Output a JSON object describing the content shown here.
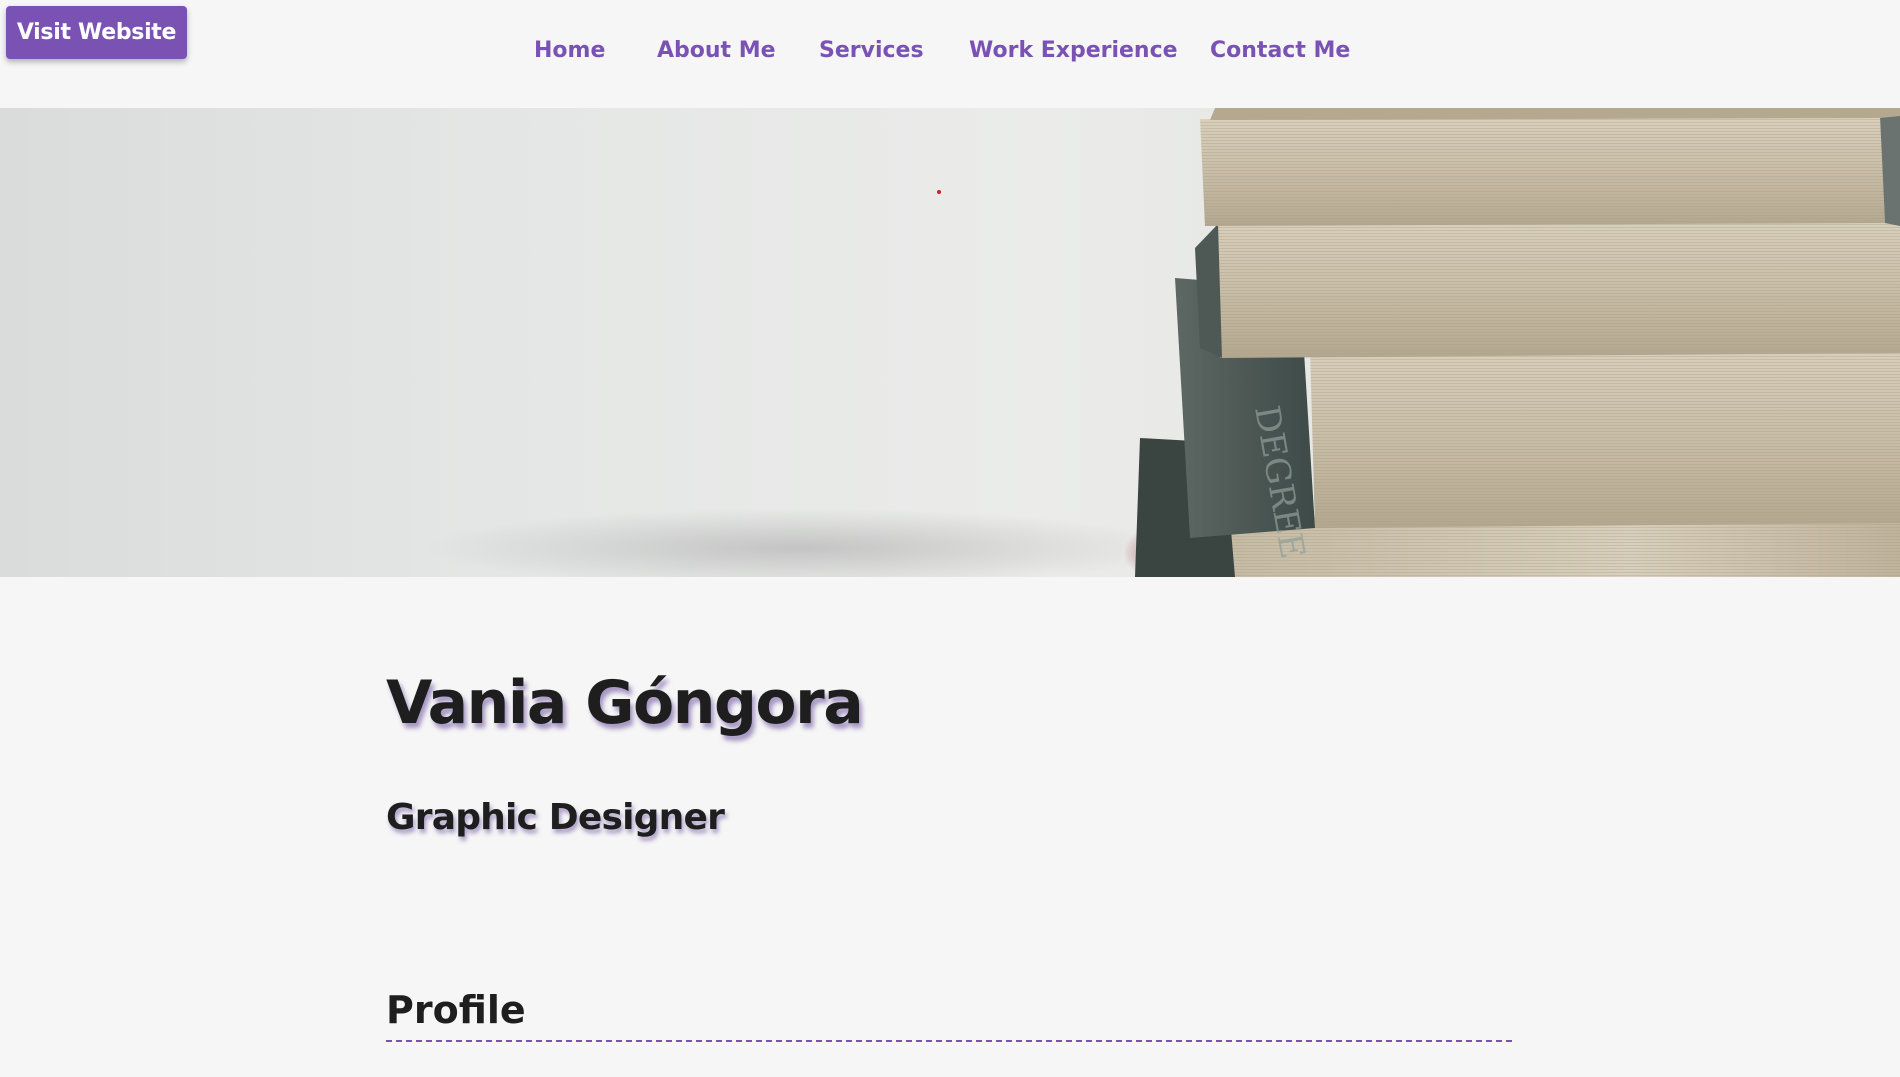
{
  "header": {
    "visit_button_label": "Visit Website",
    "nav": {
      "home": "Home",
      "about": "About Me",
      "services": "Services",
      "work": "Work Experience",
      "contact": "Contact Me"
    }
  },
  "hero": {
    "image": "stack-of-books-photo"
  },
  "profile": {
    "name": "Vania Góngora",
    "role": "Graphic Designer",
    "section_title": "Profile"
  },
  "colors": {
    "accent": "#7a52b4",
    "text": "#1e1e1e",
    "background": "#f6f6f6"
  }
}
